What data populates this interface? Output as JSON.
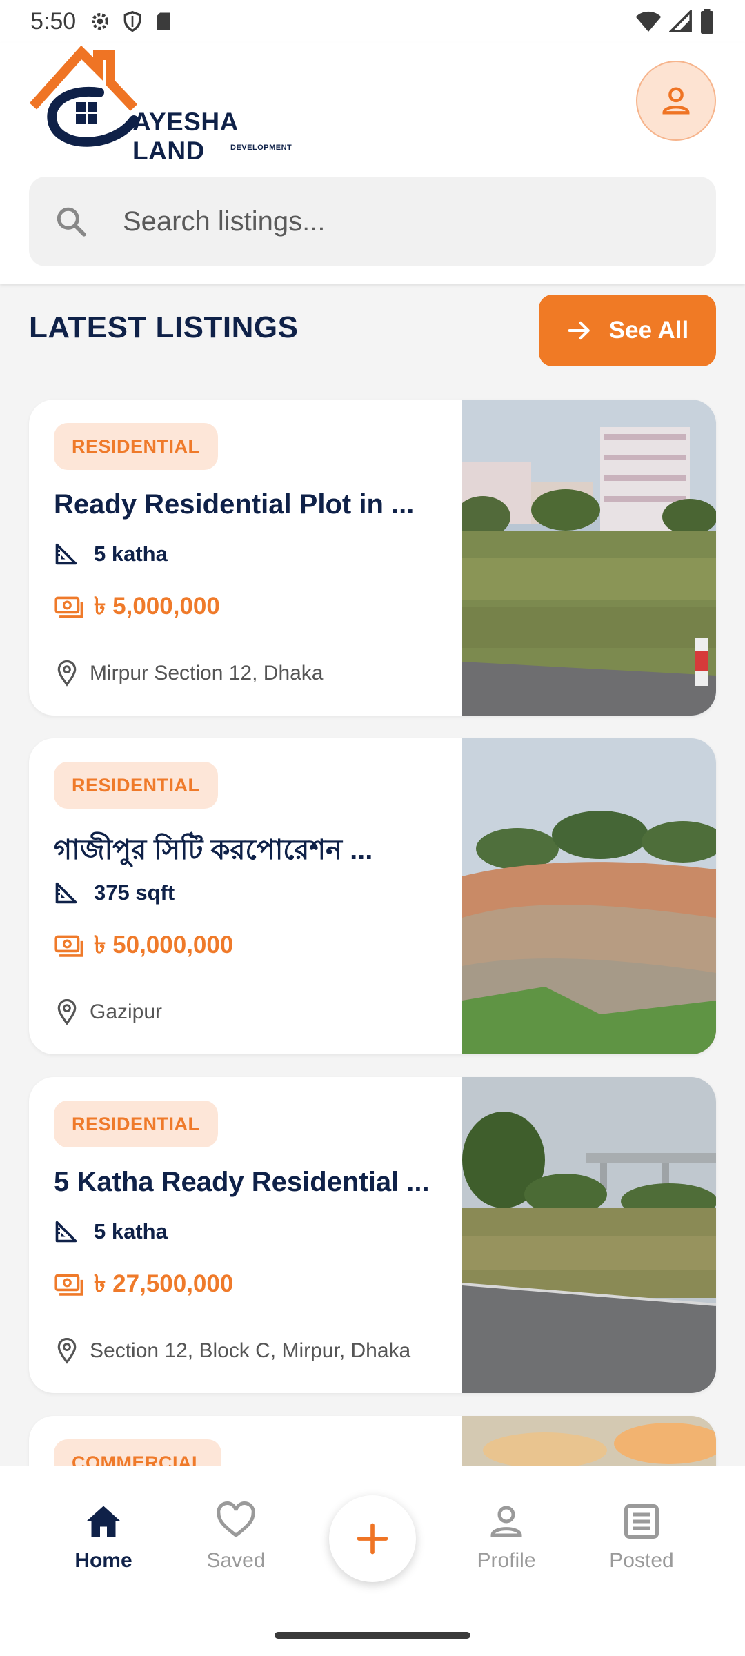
{
  "status_bar": {
    "time": "5:50"
  },
  "header": {
    "logo_title": "AYESHA LAND",
    "logo_subtitle": "DEVELOPMENT",
    "search_placeholder": "Search listings..."
  },
  "section": {
    "title": "LATEST LISTINGS",
    "see_all_label": "See All"
  },
  "listings": [
    {
      "badge": "RESIDENTIAL",
      "title": "Ready Residential Plot in ...",
      "area": "5 katha",
      "price": "৳ 5,000,000",
      "location": "Mirpur Section 12, Dhaka"
    },
    {
      "badge": "RESIDENTIAL",
      "title": "গাজীপুর সিটি করপোরেশন ...",
      "area": "375 sqft",
      "price": "৳ 50,000,000",
      "location": "Gazipur"
    },
    {
      "badge": "RESIDENTIAL",
      "title": "5 Katha Ready Residential ...",
      "area": "5 katha",
      "price": "৳ 27,500,000",
      "location": "Section 12, Block C, Mirpur, Dhaka"
    },
    {
      "badge": "COMMERCIAL"
    }
  ],
  "bottom_nav": {
    "home": "Home",
    "saved": "Saved",
    "profile": "Profile",
    "posted": "Posted"
  },
  "colors": {
    "accent": "#f07a25",
    "navy": "#0f2148",
    "badge_bg": "#fde6d8"
  }
}
